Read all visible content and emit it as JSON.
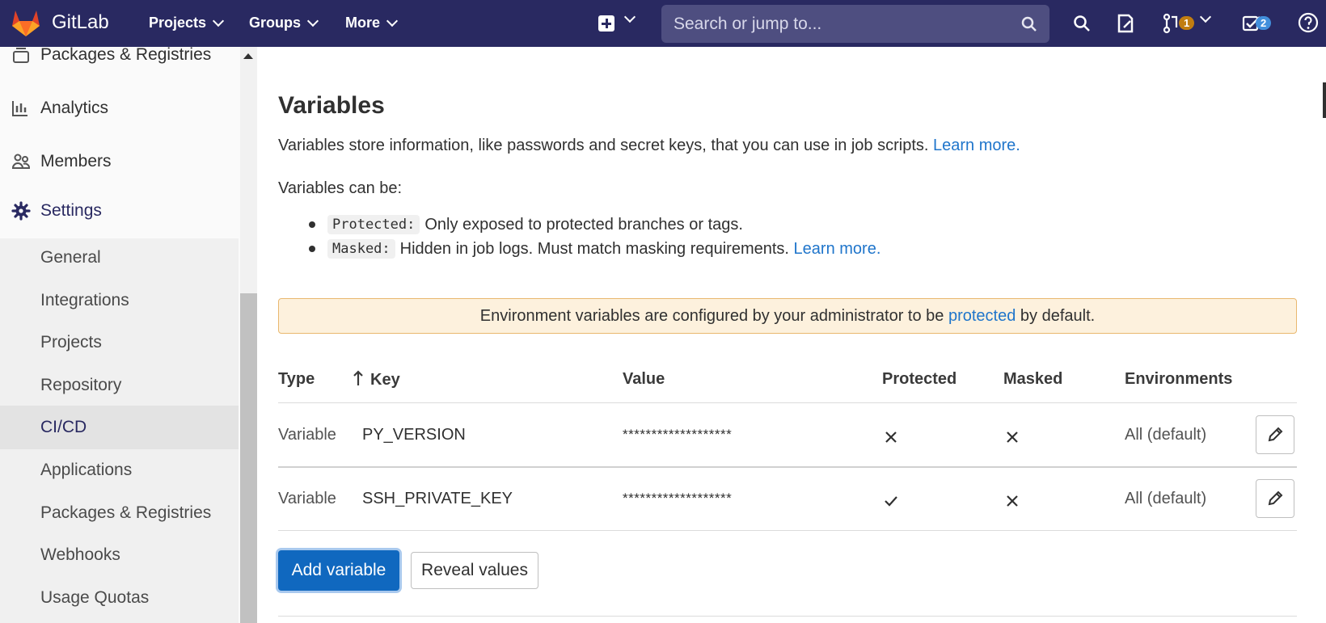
{
  "topnav": {
    "brand": "GitLab",
    "menus": [
      "Projects",
      "Groups",
      "More"
    ],
    "search_placeholder": "Search or jump to...",
    "merge_requests_count": "1",
    "todos_count": "2"
  },
  "sidebar": {
    "top_items": [
      {
        "label": "Packages & Registries",
        "icon": "package-icon"
      },
      {
        "label": "Analytics",
        "icon": "chart-icon"
      },
      {
        "label": "Members",
        "icon": "users-icon"
      }
    ],
    "settings": {
      "label": "Settings",
      "icon": "gear-icon"
    },
    "sub_items": [
      "General",
      "Integrations",
      "Projects",
      "Repository",
      "CI/CD",
      "Applications",
      "Packages & Registries",
      "Webhooks",
      "Usage Quotas"
    ],
    "active": "CI/CD"
  },
  "variables": {
    "title": "Variables",
    "description": "Variables store information, like passwords and secret keys, that you can use in job scripts.",
    "learn_more": "Learn more.",
    "can_be": "Variables can be:",
    "bullets": [
      {
        "code": "Protected:",
        "text": "Only exposed to protected branches or tags.",
        "link": ""
      },
      {
        "code": "Masked:",
        "text": "Hidden in job logs. Must match masking requirements.",
        "link": "Learn more."
      }
    ],
    "alert": {
      "before": "Environment variables are configured by your administrator to be",
      "link": "protected",
      "after": "by default."
    },
    "headers": {
      "type": "Type",
      "key": "Key",
      "value": "Value",
      "protected": "Protected",
      "masked": "Masked",
      "environments": "Environments"
    },
    "rows": [
      {
        "type": "Variable",
        "key": "PY_VERSION",
        "value": "*******************",
        "protected": false,
        "masked": false,
        "environments": "All (default)"
      },
      {
        "type": "Variable",
        "key": "SSH_PRIVATE_KEY",
        "value": "*******************",
        "protected": true,
        "masked": false,
        "environments": "All (default)"
      }
    ],
    "add_button": "Add variable",
    "reveal_button": "Reveal values"
  },
  "colors": {
    "nav": "#292961",
    "primary": "#1068bf",
    "link": "#1f75cb",
    "alert_bg": "#fdf1dd",
    "mr_badge": "#c17d10",
    "todo_badge": "#428fdc"
  }
}
